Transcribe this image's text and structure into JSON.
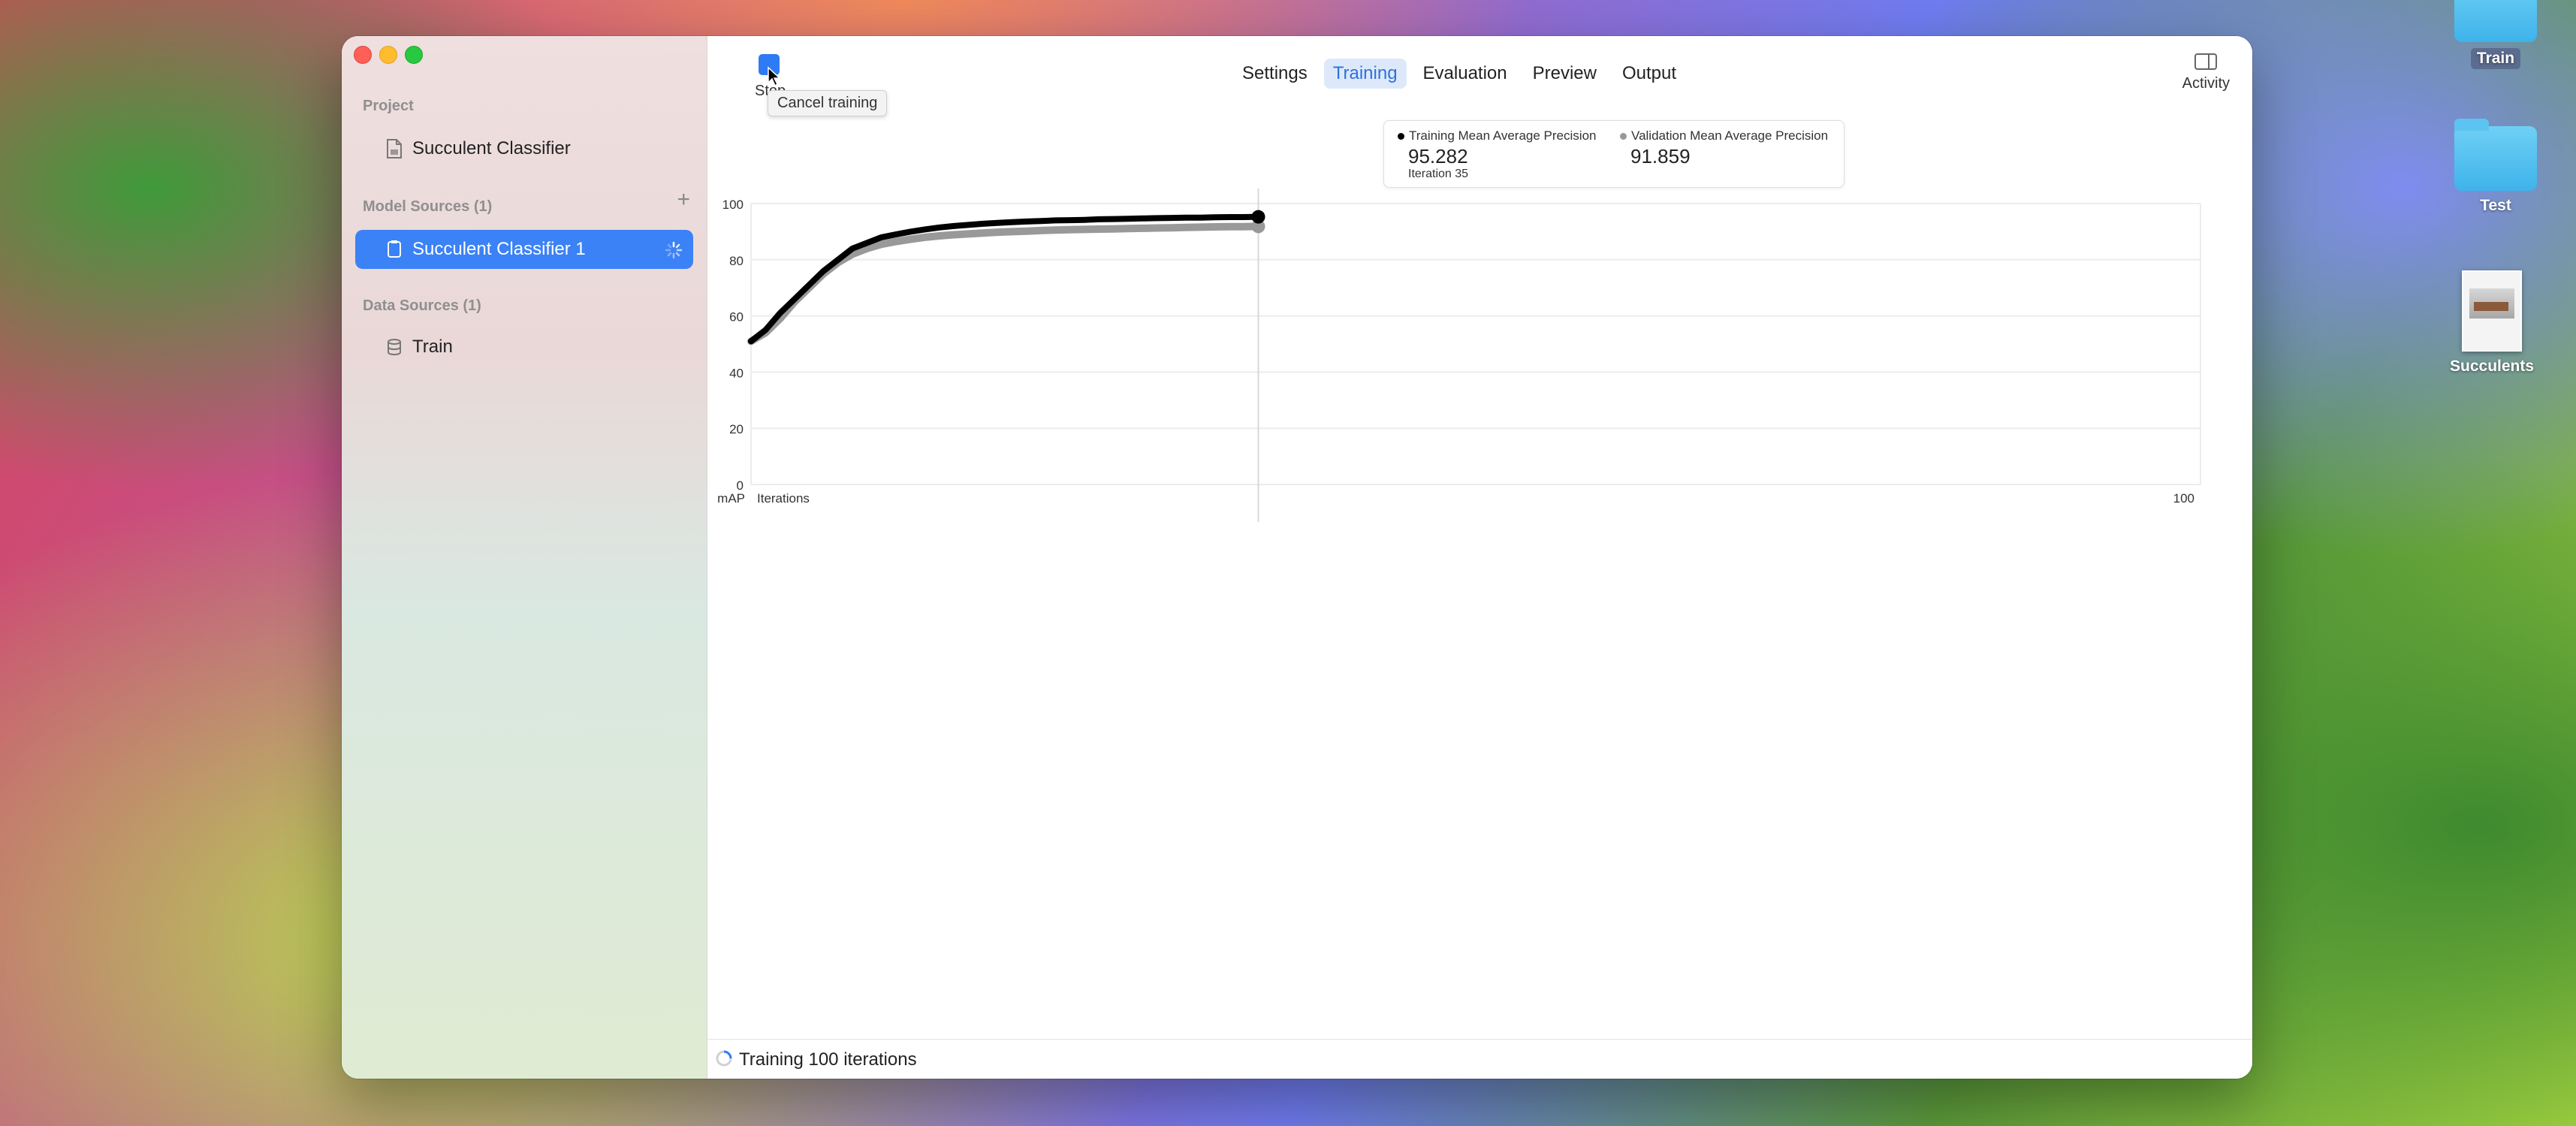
{
  "desktop": {
    "icons": [
      {
        "label": "Train"
      },
      {
        "label": "Test"
      },
      {
        "label": "Succulents"
      }
    ]
  },
  "sidebar": {
    "project_section": "Project",
    "project_item": "Succulent Classifier",
    "model_sources_section": "Model Sources (1)",
    "model_sources_add": "+",
    "model_source_item": "Succulent Classifier 1",
    "data_sources_section": "Data Sources (1)",
    "data_source_item": "Train"
  },
  "toolbar": {
    "stop_label": "Stop",
    "tooltip": "Cancel training",
    "tabs": [
      {
        "label": "Settings"
      },
      {
        "label": "Training"
      },
      {
        "label": "Evaluation"
      },
      {
        "label": "Preview"
      },
      {
        "label": "Output"
      }
    ],
    "selected_tab": "Training",
    "activity_label": "Activity"
  },
  "legend": {
    "training_name": "Training Mean Average Precision",
    "training_value": "95.282",
    "iteration": "Iteration 35",
    "validation_name": "Validation Mean Average Precision",
    "validation_value": "91.859"
  },
  "chart_data": {
    "type": "line",
    "ylabel": "mAP",
    "xlabel": "Iterations",
    "xlim": [
      0,
      100
    ],
    "ylim": [
      0,
      100
    ],
    "y_ticks": [
      "100",
      "80",
      "60",
      "40",
      "20",
      "0"
    ],
    "x_tick_end": "100",
    "x": [
      0,
      1,
      2,
      3,
      4,
      5,
      6,
      7,
      8,
      9,
      10,
      11,
      12,
      13,
      14,
      15,
      16,
      17,
      18,
      19,
      20,
      21,
      22,
      23,
      24,
      25,
      26,
      27,
      28,
      29,
      30,
      31,
      32,
      33,
      34,
      35
    ],
    "series": [
      {
        "name": "Training Mean Average Precision",
        "color": "#000000",
        "values": [
          51,
          55,
          61,
          66,
          71,
          76,
          80,
          84,
          86,
          88,
          89,
          90,
          90.8,
          91.5,
          92,
          92.4,
          92.8,
          93.1,
          93.4,
          93.6,
          93.8,
          94,
          94.1,
          94.2,
          94.4,
          94.5,
          94.6,
          94.7,
          94.8,
          94.9,
          95,
          95,
          95.1,
          95.2,
          95.2,
          95.282
        ]
      },
      {
        "name": "Validation Mean Average Precision",
        "color": "#999999",
        "values": [
          51,
          54,
          59,
          65,
          70,
          75,
          79,
          82,
          84,
          85.5,
          86.5,
          87.3,
          88,
          88.5,
          88.9,
          89.2,
          89.5,
          89.8,
          90,
          90.2,
          90.4,
          90.6,
          90.7,
          90.8,
          90.9,
          91,
          91.1,
          91.2,
          91.3,
          91.4,
          91.5,
          91.6,
          91.7,
          91.8,
          91.8,
          91.859
        ]
      }
    ],
    "hover_iteration": 35
  },
  "status": {
    "text": "Training 100 iterations"
  }
}
